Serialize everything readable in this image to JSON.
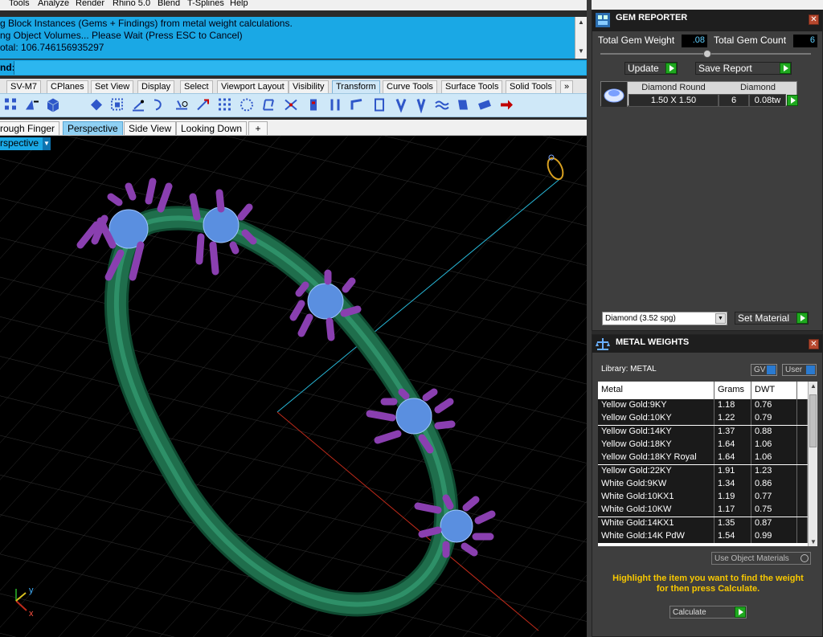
{
  "menu": [
    "Tools",
    "Analyze",
    "Render",
    "Rhino 5.0",
    "Blend",
    "T-Splines",
    "Help"
  ],
  "command_history": [
    "g Block Instances (Gems + Findings) from metal weight calculations.",
    "ng Object Volumes... Please Wait (Press ESC to Cancel)",
    "otal: 106.746156935297"
  ],
  "command_prompt": "nd:",
  "toolbar_tabs": [
    "SV-M7",
    "CPlanes",
    "Set View",
    "Display",
    "Select",
    "Viewport Layout",
    "Visibility",
    "Transform",
    "Curve Tools",
    "Surface Tools",
    "Solid Tools"
  ],
  "toolbar_more": "»",
  "active_toolbar_tab": "Transform",
  "viewport_tabs": [
    "rough Finger",
    "Perspective",
    "Side View",
    "Looking Down"
  ],
  "viewport_add": "+",
  "active_viewport_tab": "Perspective",
  "viewport_label": "rspective",
  "axis_labels": {
    "y": "y",
    "x": "x"
  },
  "gem_reporter": {
    "title": "GEM REPORTER",
    "total_weight_label": "Total Gem Weight",
    "total_weight": ".08",
    "total_count_label": "Total Gem Count",
    "total_count": "6",
    "update_label": "Update",
    "save_label": "Save Report",
    "table_headers": [
      "Diamond Round",
      "Diamond"
    ],
    "table_row": {
      "size": "1.50 X 1.50",
      "count": "6",
      "weight": "0.08tw"
    },
    "material_select": "Diamond      (3.52 spg)",
    "set_material_label": "Set Material"
  },
  "metal_weights": {
    "title": "METAL WEIGHTS",
    "library_label": "Library: METAL",
    "gv_label": "GV",
    "user_label": "User",
    "columns": [
      "Metal",
      "Grams",
      "DWT"
    ],
    "rows": [
      [
        "Yellow Gold:9KY",
        "1.18",
        "0.76"
      ],
      [
        "Yellow Gold:10KY",
        "1.22",
        "0.79"
      ],
      [
        "Yellow Gold:14KY",
        "1.37",
        "0.88"
      ],
      [
        "Yellow Gold:18KY",
        "1.64",
        "1.06"
      ],
      [
        "Yellow Gold:18KY Royal",
        "1.64",
        "1.06"
      ],
      [
        "Yellow Gold:22KY",
        "1.91",
        "1.23"
      ],
      [
        "White Gold:9KW",
        "1.34",
        "0.86"
      ],
      [
        "White Gold:10KX1",
        "1.19",
        "0.77"
      ],
      [
        "White Gold:10KW",
        "1.17",
        "0.75"
      ],
      [
        "White Gold:14KX1",
        "1.35",
        "0.87"
      ],
      [
        "White Gold:14K PdW",
        "1.54",
        "0.99"
      ]
    ],
    "use_object_materials_label": "Use Object Materials",
    "hint_line1": "Highlight the item you want to find the weight",
    "hint_line2": "for then press Calculate.",
    "calculate_label": "Calculate"
  },
  "colors": {
    "ring": "#1f6e4c",
    "prongs": "#8a3fb0",
    "gem": "#6aa6ff",
    "accent": "#1aa8e5",
    "hint": "#f8c800"
  }
}
